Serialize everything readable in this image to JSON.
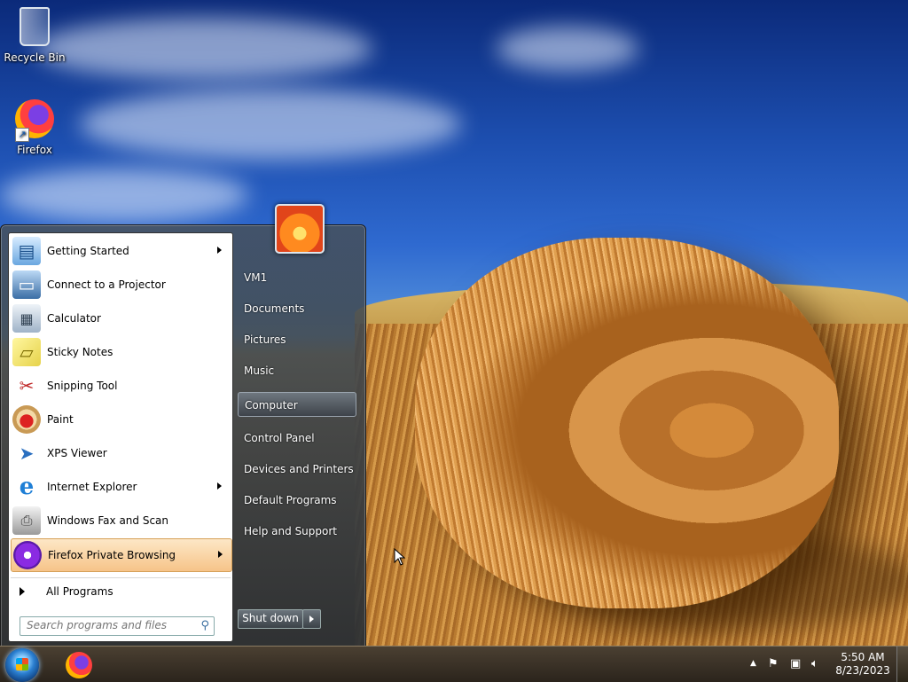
{
  "desktop": {
    "icons": [
      {
        "label": "Recycle Bin",
        "icon": "recycle-bin-icon"
      },
      {
        "label": "Firefox",
        "icon": "firefox-icon"
      }
    ]
  },
  "start_menu": {
    "programs": [
      {
        "label": "Getting Started",
        "icon": "getting-started-icon",
        "has_submenu": true
      },
      {
        "label": "Connect to a Projector",
        "icon": "projector-icon",
        "has_submenu": false
      },
      {
        "label": "Calculator",
        "icon": "calculator-icon",
        "has_submenu": false
      },
      {
        "label": "Sticky Notes",
        "icon": "sticky-notes-icon",
        "has_submenu": false
      },
      {
        "label": "Snipping Tool",
        "icon": "scissors-icon",
        "has_submenu": false
      },
      {
        "label": "Paint",
        "icon": "paint-palette-icon",
        "has_submenu": false
      },
      {
        "label": "XPS Viewer",
        "icon": "paper-plane-icon",
        "has_submenu": false
      },
      {
        "label": "Internet Explorer",
        "icon": "internet-explorer-icon",
        "has_submenu": true
      },
      {
        "label": "Windows Fax and Scan",
        "icon": "fax-icon",
        "has_submenu": false
      },
      {
        "label": "Firefox Private Browsing",
        "icon": "firefox-private-icon",
        "has_submenu": true,
        "highlighted": true
      }
    ],
    "all_programs": "All Programs",
    "search_placeholder": "Search programs and files",
    "right_items": [
      {
        "label": "VM1"
      },
      {
        "label": "Documents"
      },
      {
        "label": "Pictures"
      },
      {
        "label": "Music"
      },
      {
        "label": "Computer",
        "highlighted": true
      },
      {
        "label": "Control Panel"
      },
      {
        "label": "Devices and Printers"
      },
      {
        "label": "Default Programs"
      },
      {
        "label": "Help and Support"
      }
    ],
    "shutdown_label": "Shut down"
  },
  "taskbar": {
    "clock_time": "5:50 AM",
    "clock_date": "8/23/2023"
  }
}
